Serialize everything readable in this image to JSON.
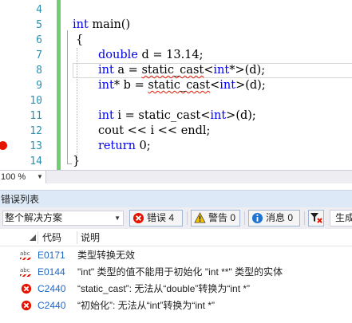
{
  "editor": {
    "line_numbers": [
      "4",
      "5",
      "6",
      "7",
      "8",
      "9",
      "10",
      "11",
      "12",
      "13",
      "14"
    ],
    "breakpoint_line": "13",
    "code": {
      "l5": {
        "kw": "int",
        "rest": " main()"
      },
      "l6": {
        "text": "{"
      },
      "l7": {
        "kw": "double",
        "rest": " d = 13.14;"
      },
      "l8": {
        "kw1": "int",
        "mid1": " a = ",
        "err": "static_cast",
        "mid2": "<",
        "kw2": "int",
        "rest": "*>(d);"
      },
      "l9": {
        "kw1": "int",
        "mid1": "* b = ",
        "err": "static_cast",
        "mid2": "<",
        "kw2": "int",
        "rest": ">(d);"
      },
      "l11": {
        "kw1": "int",
        "mid1": " i = static_cast<",
        "kw2": "int",
        "rest": ">(d);"
      },
      "l12": {
        "text": "cout << i << endl;"
      },
      "l13": {
        "kw": "return",
        "rest": " 0;"
      },
      "l14": {
        "text": "}"
      }
    },
    "zoom": "100 %"
  },
  "error_list": {
    "title": "错误列表",
    "scope": "整个解决方案",
    "errors_label": "错误 4",
    "warnings_label": "警告 0",
    "messages_label": "消息 0",
    "build_label": "生成",
    "columns": {
      "code": "代码",
      "description": "说明"
    },
    "rows": [
      {
        "type": "intellisense",
        "code": "E0171",
        "description": "类型转换无效"
      },
      {
        "type": "intellisense",
        "code": "E0144",
        "description": "\"int\" 类型的值不能用于初始化 \"int **\" 类型的实体"
      },
      {
        "type": "error",
        "code": "C2440",
        "description": "“static_cast”: 无法从“double”转换为“int *”"
      },
      {
        "type": "error",
        "code": "C2440",
        "description": "“初始化”: 无法从“int”转换为“int *”"
      }
    ]
  },
  "colors": {
    "keyword": "#0000ff",
    "line_number": "#2b91af",
    "error": "#e51400",
    "change_bar": "#6fce6f",
    "panel_title_bg": "#dde9f6"
  },
  "icons": {
    "breakpoint": "breakpoint-icon",
    "error": "error-circle-icon",
    "warning": "warning-triangle-icon",
    "message": "info-circle-icon",
    "filter": "filter-icon",
    "intellisense": "squiggle-abc-icon"
  }
}
